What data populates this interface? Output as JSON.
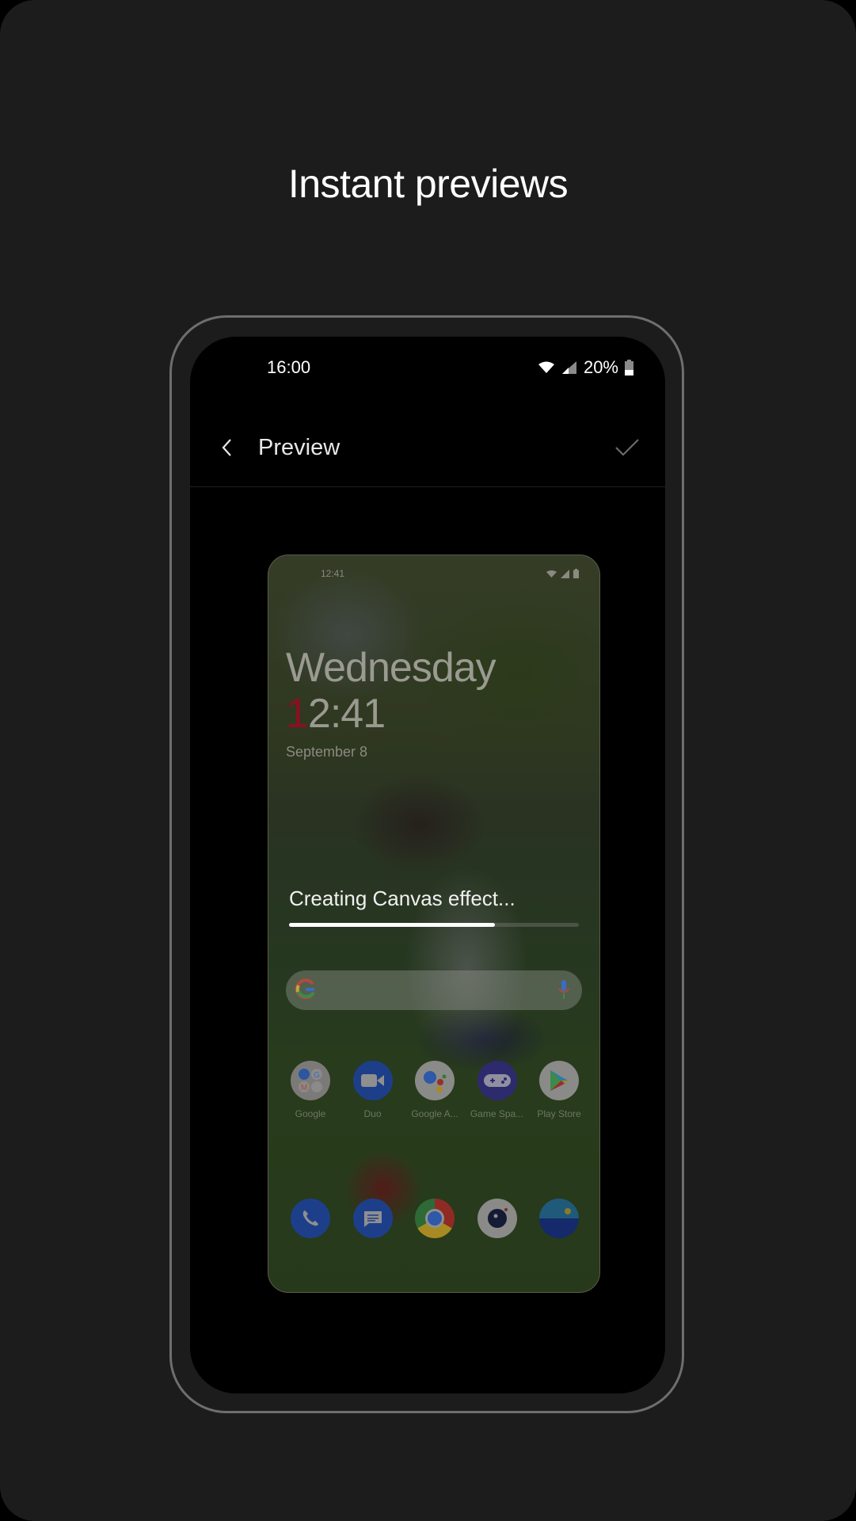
{
  "headline": "Instant previews",
  "phone": {
    "status_bar": {
      "time": "16:00",
      "battery_percent": "20%",
      "icons": [
        "wifi-icon",
        "cell-signal-icon",
        "battery-icon"
      ]
    },
    "app_bar": {
      "title": "Preview",
      "back_icon": "chevron-left-icon",
      "confirm_icon": "check-icon"
    },
    "preview": {
      "status_time": "12:41",
      "day": "Wednesday",
      "clock_first_digit": "1",
      "clock_rest": "2:41",
      "date": "September 8",
      "progress_label": "Creating Canvas effect...",
      "progress_fraction": 0.71,
      "search_bar": {
        "left_icon": "google-g-icon",
        "right_icon": "microphone-icon"
      },
      "apps": [
        {
          "label": "Google",
          "icon": "google-folder-icon"
        },
        {
          "label": "Duo",
          "icon": "duo-icon"
        },
        {
          "label": "Google A...",
          "icon": "google-assistant-icon"
        },
        {
          "label": "Game Spa...",
          "icon": "game-space-icon"
        },
        {
          "label": "Play Store",
          "icon": "play-store-icon"
        }
      ],
      "dock": [
        {
          "icon": "phone-icon"
        },
        {
          "icon": "messages-icon"
        },
        {
          "icon": "chrome-icon"
        },
        {
          "icon": "camera-icon"
        },
        {
          "icon": "gallery-icon"
        }
      ]
    }
  }
}
